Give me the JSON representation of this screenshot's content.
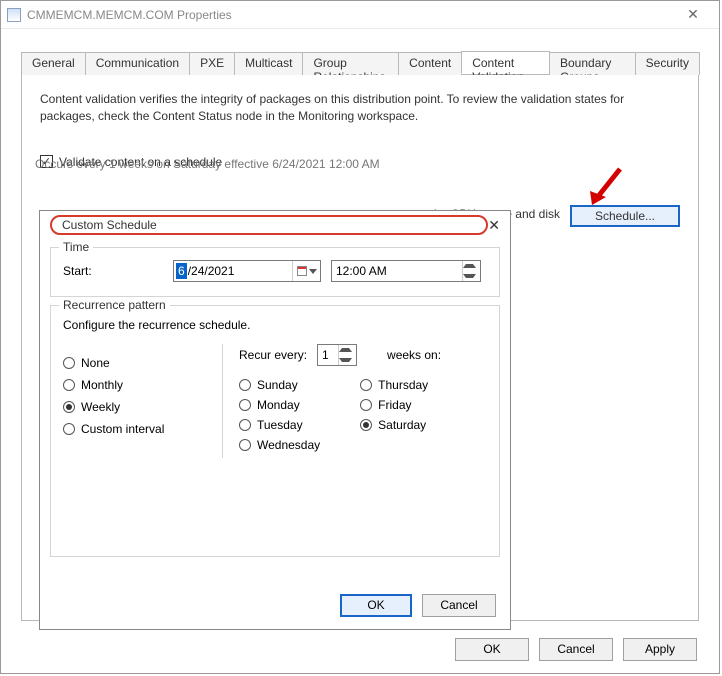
{
  "window": {
    "title": "CMMEMCM.MEMCM.COM Properties"
  },
  "tabs": [
    "General",
    "Communication",
    "PXE",
    "Multicast",
    "Group Relationships",
    "Content",
    "Content Validation",
    "Boundary Groups",
    "Security"
  ],
  "active_tab": "Content Validation",
  "panel": {
    "description": "Content validation verifies the integrity of packages on this distribution point. To review the validation states for packages, check the Content Status node in the Monitoring workspace.",
    "validate_label": "Validate content on a schedule",
    "occurs_text": "Occurs every 1 weeks on Saturday effective 6/24/2021 12:00 AM",
    "schedule_btn": "Schedule...",
    "side_text": "e the CPU usage and disk"
  },
  "dialog": {
    "title": "Custom Schedule",
    "time": {
      "legend": "Time",
      "start_label": "Start:",
      "date_sel": "6",
      "date_rest": "/24/2021",
      "time_value": "12:00 AM"
    },
    "recurrence": {
      "legend": "Recurrence pattern",
      "configure": "Configure the recurrence schedule.",
      "options": {
        "none": "None",
        "monthly": "Monthly",
        "weekly": "Weekly",
        "custom": "Custom interval"
      },
      "selected": "weekly",
      "recur_label": "Recur every:",
      "recur_value": "1",
      "weeks_on": "weeks on:",
      "days": {
        "sunday": "Sunday",
        "monday": "Monday",
        "tuesday": "Tuesday",
        "wednesday": "Wednesday",
        "thursday": "Thursday",
        "friday": "Friday",
        "saturday": "Saturday"
      },
      "selected_day": "saturday"
    },
    "ok": "OK",
    "cancel": "Cancel"
  },
  "footer": {
    "ok": "OK",
    "cancel": "Cancel",
    "apply": "Apply"
  }
}
